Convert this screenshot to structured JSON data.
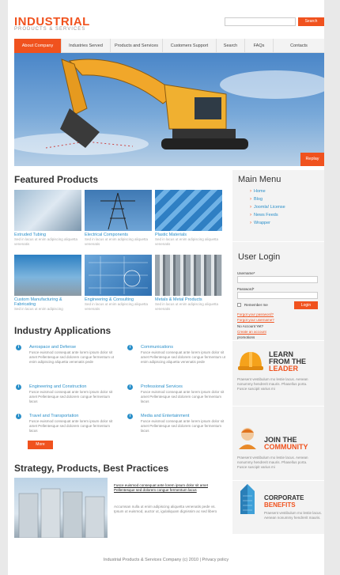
{
  "header": {
    "logo_title": "INDUSTRIAL",
    "logo_subtitle": "PRODUCTS & SERVICES",
    "search_button": "Search"
  },
  "nav": {
    "items": [
      {
        "label": "About Company"
      },
      {
        "label": "Industries Served"
      },
      {
        "label": "Products and Services"
      },
      {
        "label": "Customers Support"
      },
      {
        "label": "Search"
      },
      {
        "label": "FAQs"
      },
      {
        "label": "Contacts"
      }
    ]
  },
  "hero": {
    "replay_label": "Replay"
  },
  "featured": {
    "heading": "Featured Products",
    "items": [
      {
        "title": "Extruded Tubing",
        "desc": "Sed in lacus ut enim adipiscing aliquetta venenatis"
      },
      {
        "title": "Electrical Components",
        "desc": "Sed in lacus ut enim adipiscing aliquetta venenatis"
      },
      {
        "title": "Plastic Materials",
        "desc": "Sed in lacus ut enim adipiscing aliquetta venenatis"
      },
      {
        "title": "Custom Manufacturing & Fabricating",
        "desc": "Sed in lacus ut enim adipiscing"
      },
      {
        "title": "Engineering & Consulting",
        "desc": "Sed in lacus ut enim adipiscing aliquetta venenatis"
      },
      {
        "title": "Metals & Metal Products",
        "desc": "Sed in lacus ut enim adipiscing aliquetta venenatis"
      }
    ]
  },
  "applications": {
    "heading": "Industry Applications",
    "items": [
      {
        "title": "Aerospace and Defense",
        "desc": "Fusce euismod consequat ante lorem ipsum dolor sit amet Pellentesque sed dolorem congue fermentum ut enim adipiscing aliquetta venenatis pede"
      },
      {
        "title": "Communications",
        "desc": "Fusce euismod consequat ante lorem ipsum dolor sit amet Pellentesque sed dolorem congue fermentum ut enim adipiscing aliquetta venenatis pede"
      },
      {
        "title": "Engineering and Construction",
        "desc": "Fusce euismod consequat ante lorem ipsum dolor sit amet Pellentesque sed dolorem congue fermentum lacus"
      },
      {
        "title": "Professional Services",
        "desc": "Fusce euismod consequat ante lorem ipsum dolor sit amet Pellentesque sed dolorem congue fermentum lacus"
      },
      {
        "title": "Travel and Transportation",
        "desc": "Fusce euismod consequat ante lorem ipsum dolor sit amet Pellentesque sed dolorem congue fermentum lacus"
      },
      {
        "title": "Media and Entertainment",
        "desc": "Fusce euismod consequat ante lorem ipsum dolor sit amet Pellentesque sed dolorem congue fermentum lacus"
      }
    ],
    "more_button": "More"
  },
  "strategy": {
    "heading": "Strategy, Products, Best Practices",
    "lead": "Fusce euismod consequat ante lorem ipsum dolor sit amet Pellentesque sed dolorem congue fermentum lacus",
    "body": "Accumsan nulla ut enim adipiscing aliquetta venenatis pede vs. Ipsum ut euismod, auctor ut, igulaliquam dignissim ac sed libero"
  },
  "sidebar": {
    "menu_heading": "Main Menu",
    "menu_items": [
      "Home",
      "Blog",
      "Joomla! License",
      "News Feeds",
      "Wrapper"
    ],
    "login": {
      "heading": "User Login",
      "username_label": "Username*",
      "password_label": "Password*",
      "remember_label": "Remember me",
      "login_button": "Login",
      "forgot_password": "Forgot your password?",
      "forgot_username": "Forgot your username?",
      "no_account": "No Account Yet?",
      "create_account": "Create an account"
    },
    "promotions_label": "promotions",
    "promos": [
      {
        "title_1": "LEARN",
        "title_2": "FROM THE",
        "title_3": "LEADER",
        "desc": "Praesent vestibulum mo lestie lacus. Aenean nonummy hendrerit mauris. Phasellus porta. Fusce suscipit varius mi"
      },
      {
        "title_1": "JOIN THE",
        "title_2": "COMMUNITY",
        "desc": "Praesent vestibulum mo lestie lacus. Aenean nonummy hendrerit mauris. Phasellus porta. Fusce suscipit varius mi"
      },
      {
        "title_1": "CORPORATE",
        "title_2": "BENEFITS",
        "desc": "Praesent vestibulum mo lestie lacus. Aenean nonummy hendrerit mauris."
      }
    ]
  },
  "footer": {
    "text": "Industrial Products & Services Company (c) 2010 | Privacy policy"
  },
  "colors": {
    "accent": "#f0521e",
    "link": "#2a8fc9"
  }
}
